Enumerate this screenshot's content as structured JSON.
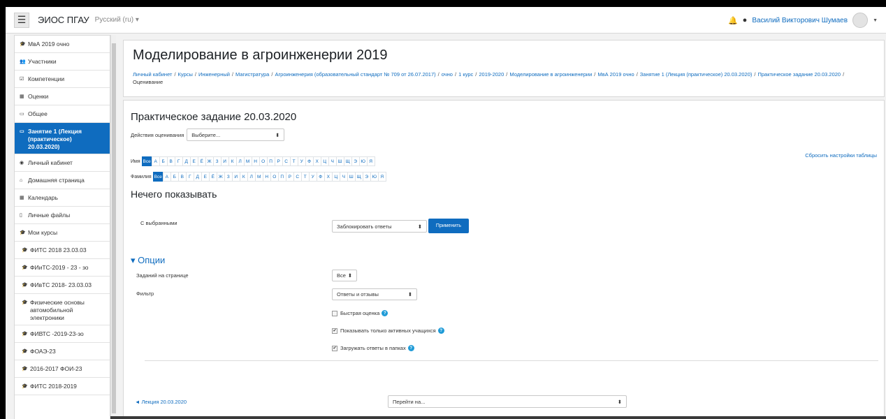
{
  "navbar": {
    "site_name": "ЭИОС ПГАУ",
    "language": "Русский (ru) ▾",
    "user_name": "Василий Викторович Шумаев"
  },
  "sidebar": {
    "items": [
      {
        "label": "МвА 2019 очно",
        "icon": "graduation-cap-icon",
        "glyph": "🎓"
      },
      {
        "label": "Участники",
        "icon": "users-icon",
        "glyph": "👥"
      },
      {
        "label": "Компетенции",
        "icon": "check-square-icon",
        "glyph": "☑"
      },
      {
        "label": "Оценки",
        "icon": "table-icon",
        "glyph": "▦"
      },
      {
        "label": "Общее",
        "icon": "folder-icon",
        "glyph": "▭"
      },
      {
        "label": "Занятие 1 (Лекция (практическое) 20.03.2020)",
        "icon": "folder-icon",
        "glyph": "▭",
        "active": true
      },
      {
        "label": "Личный кабинет",
        "icon": "dashboard-icon",
        "glyph": "◉"
      },
      {
        "label": "Домашняя страница",
        "icon": "home-icon",
        "glyph": "⌂"
      },
      {
        "label": "Календарь",
        "icon": "calendar-icon",
        "glyph": "▦"
      },
      {
        "label": "Личные файлы",
        "icon": "file-icon",
        "glyph": "▯"
      },
      {
        "label": "Мои курсы",
        "icon": "graduation-cap-icon",
        "glyph": "🎓"
      },
      {
        "label": "ФИТС 2018 23.03.03",
        "icon": "graduation-cap-icon",
        "glyph": "🎓",
        "sub": true
      },
      {
        "label": "ФИиТС-2019 - 23 - зо",
        "icon": "graduation-cap-icon",
        "glyph": "🎓",
        "sub": true
      },
      {
        "label": "ФИвТС 2018- 23.03.03",
        "icon": "graduation-cap-icon",
        "glyph": "🎓",
        "sub": true
      },
      {
        "label": "Физические основы автомобильной электроники",
        "icon": "graduation-cap-icon",
        "glyph": "🎓",
        "sub": true
      },
      {
        "label": "ФИВТС -2019-23-зо",
        "icon": "graduation-cap-icon",
        "glyph": "🎓",
        "sub": true
      },
      {
        "label": "ФОАЭ-23",
        "icon": "graduation-cap-icon",
        "glyph": "🎓",
        "sub": true
      },
      {
        "label": "2016-2017 ФОИ-23",
        "icon": "graduation-cap-icon",
        "glyph": "🎓",
        "sub": true
      },
      {
        "label": "ФИТС 2018-2019",
        "icon": "graduation-cap-icon",
        "glyph": "🎓",
        "sub": true
      }
    ]
  },
  "header": {
    "course_title": "Моделирование в агроинженерии 2019",
    "breadcrumb": [
      "Личный кабинет",
      "Курсы",
      "Инженерный",
      "Магистратура",
      "Агроинженерия (образовательный стандарт № 709 от 26.07.2017)",
      "очно",
      "1 курс",
      "2019-2020",
      "Моделирование в агроинженерии",
      "МвА 2019 очно",
      "Занятие 1 (Лекция (практическое) 20.03.2020)",
      "Практическое задание 20.03.2020"
    ],
    "breadcrumb_current": "Оценивание"
  },
  "main": {
    "title": "Практическое задание 20.03.2020",
    "grading_label": "Действия оценивания",
    "grading_select": "Выберите...",
    "reset_link": "Сбросить настройки таблицы",
    "first_name_label": "Имя",
    "last_name_label": "Фамилия",
    "all_label": "Все",
    "letters": [
      "А",
      "Б",
      "В",
      "Г",
      "Д",
      "Е",
      "Ё",
      "Ж",
      "З",
      "И",
      "К",
      "Л",
      "М",
      "Н",
      "О",
      "П",
      "Р",
      "С",
      "Т",
      "У",
      "Ф",
      "Х",
      "Ц",
      "Ч",
      "Ш",
      "Щ",
      "Э",
      "Ю",
      "Я"
    ],
    "nothing_to_show": "Нечего показывать",
    "with_selected_label": "С выбранными",
    "bulk_action": "Заблокировать ответы",
    "apply_button": "Применить",
    "options_header": "▾ Опции",
    "per_page_label": "Заданий на странице",
    "per_page_value": "Все",
    "filter_label": "Фильтр",
    "filter_value": "Ответы и отзывы",
    "quick_grading": "Быстрая оценка",
    "quick_grading_checked": false,
    "active_only": "Показывать только активных учащихся",
    "active_only_checked": true,
    "download_folders": "Загружать ответы в папках",
    "download_folders_checked": true,
    "prev_link": "◄ Лекция 20.03.2020",
    "jump_to": "Перейти на..."
  }
}
